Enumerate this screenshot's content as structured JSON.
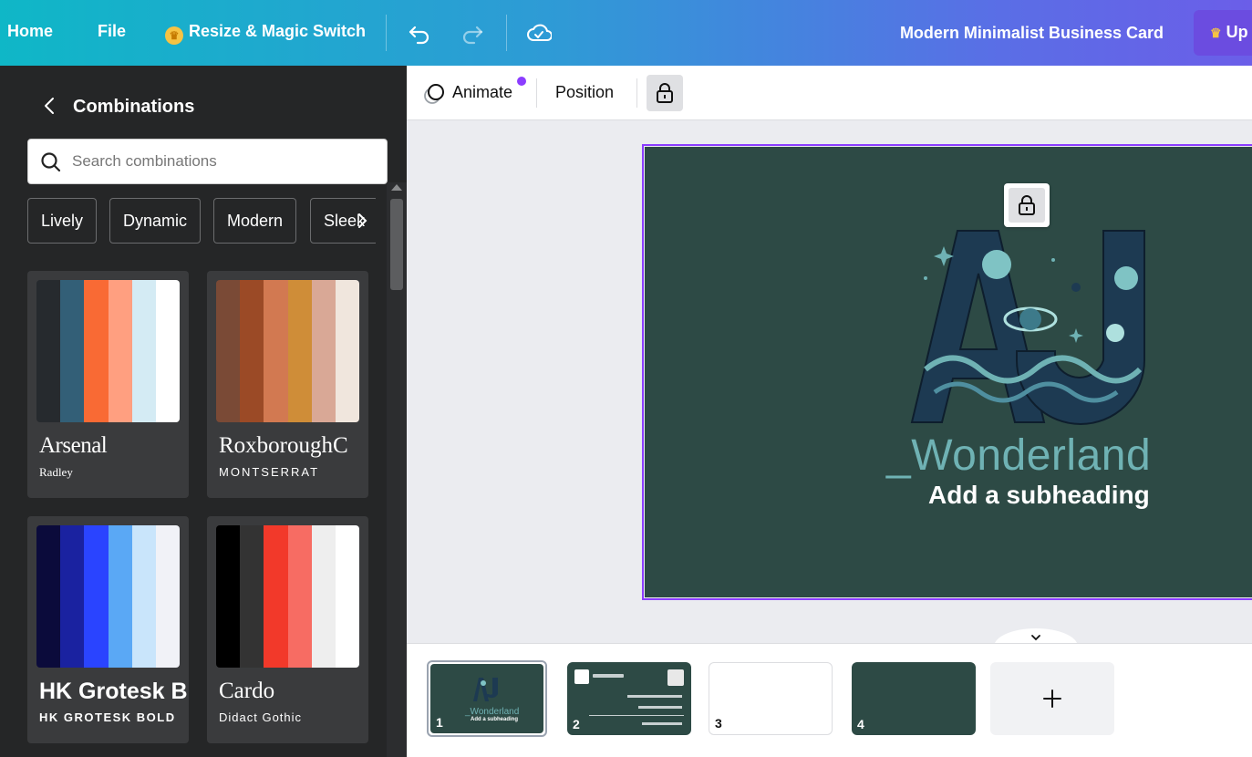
{
  "topbar": {
    "home": "Home",
    "file": "File",
    "resize": "Resize & Magic Switch",
    "doc_title": "Modern Minimalist Business Card",
    "upgrade": "Up"
  },
  "context_bar": {
    "animate": "Animate",
    "position": "Position"
  },
  "panel": {
    "title": "Combinations",
    "search_placeholder": "Search combinations",
    "chips": [
      "Lively",
      "Dynamic",
      "Modern",
      "Sleek"
    ],
    "combos": [
      {
        "heading": "Arsenal",
        "subheading": "Radley",
        "colors": [
          "#262a2e",
          "#335f77",
          "#f96a34",
          "#ff9f80",
          "#d4ebf4",
          "#ffffff"
        ]
      },
      {
        "heading": "RoxboroughC",
        "subheading": "MONTSERRAT",
        "colors": [
          "#7a4a36",
          "#9b4a26",
          "#d27951",
          "#cf8d38",
          "#d9a896",
          "#f0e6dd"
        ]
      },
      {
        "heading": "HK Grotesk B",
        "subheading": "HK GROTESK BOLD",
        "colors": [
          "#0b0b3b",
          "#1a22a0",
          "#2a44ff",
          "#5aa8f5",
          "#c9e5fb",
          "#f1f2f7"
        ]
      },
      {
        "heading": "Cardo",
        "subheading": "Didact Gothic",
        "colors": [
          "#000000",
          "#333333",
          "#f2392a",
          "#f76c63",
          "#eeeeee",
          "#ffffff"
        ]
      }
    ]
  },
  "card": {
    "title": "_Wonderland",
    "subheading": "Add a subheading",
    "background": "#2d4a45",
    "title_color": "#6fb2b4"
  },
  "pages": {
    "items": [
      {
        "num": "1",
        "mini_title": "_Wonderland",
        "mini_sub": "Add a subheading"
      },
      {
        "num": "2"
      },
      {
        "num": "3"
      },
      {
        "num": "4"
      }
    ]
  },
  "icons": {
    "undo": "undo-icon",
    "redo": "redo-icon",
    "cloud": "cloud-check-icon",
    "lock": "lock-icon",
    "search": "search-icon",
    "add": "plus-icon"
  }
}
